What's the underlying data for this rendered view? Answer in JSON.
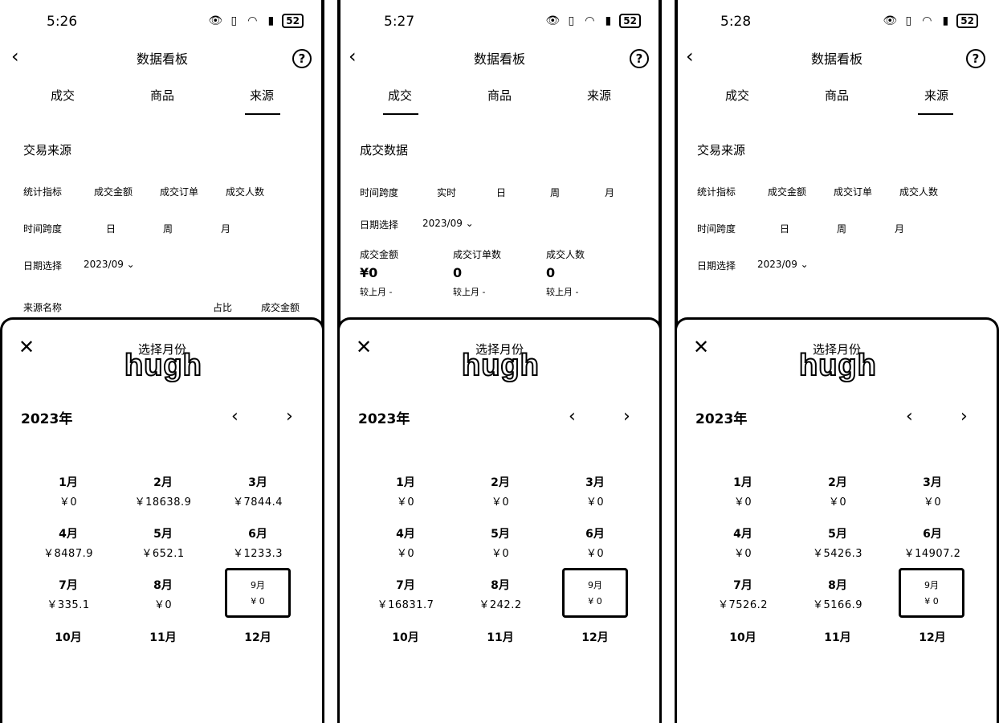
{
  "status": {
    "battery": "52"
  },
  "nav": {
    "title": "数据看板",
    "help": "?"
  },
  "tabs": [
    "成交",
    "商品",
    "来源"
  ],
  "labels": {
    "source_title": "交易来源",
    "deal_title": "成交数据",
    "metric_label": "统计指标",
    "metric_amount": "成交金额",
    "metric_orders": "成交订单",
    "metric_buyers": "成交人数",
    "time_span": "时间跨度",
    "realtime": "实时",
    "day": "日",
    "week": "周",
    "month": "月",
    "date_select": "日期选择",
    "date_value": "2023/09 ⌄",
    "source_name": "来源名称",
    "ratio": "占比",
    "amount": "成交金额",
    "deal_amount": "成交金额",
    "deal_orders": "成交订单数",
    "deal_buyers": "成交人数",
    "deal_amount_val": "¥0",
    "deal_orders_val": "0",
    "deal_buyers_val": "0",
    "compare": "较上月 -"
  },
  "sheet": {
    "title": "选择月份",
    "watermark": "hugh",
    "year": "2023年",
    "sel_top": "9月",
    "sel_bottom": "¥ 0"
  },
  "panels": [
    {
      "time": "5:26",
      "months": [
        {
          "label": "1月",
          "amount": "￥0"
        },
        {
          "label": "2月",
          "amount": "￥18638.9"
        },
        {
          "label": "3月",
          "amount": "￥7844.4"
        },
        {
          "label": "4月",
          "amount": "￥8487.9"
        },
        {
          "label": "5月",
          "amount": "￥652.1"
        },
        {
          "label": "6月",
          "amount": "￥1233.3"
        },
        {
          "label": "7月",
          "amount": "￥335.1"
        },
        {
          "label": "8月",
          "amount": "￥0"
        },
        {
          "label": "10月",
          "amount": ""
        },
        {
          "label": "11月",
          "amount": ""
        },
        {
          "label": "12月",
          "amount": ""
        }
      ]
    },
    {
      "time": "5:27",
      "months": [
        {
          "label": "1月",
          "amount": "￥0"
        },
        {
          "label": "2月",
          "amount": "￥0"
        },
        {
          "label": "3月",
          "amount": "￥0"
        },
        {
          "label": "4月",
          "amount": "￥0"
        },
        {
          "label": "5月",
          "amount": "￥0"
        },
        {
          "label": "6月",
          "amount": "￥0"
        },
        {
          "label": "7月",
          "amount": "￥16831.7"
        },
        {
          "label": "8月",
          "amount": "￥242.2"
        },
        {
          "label": "10月",
          "amount": ""
        },
        {
          "label": "11月",
          "amount": ""
        },
        {
          "label": "12月",
          "amount": ""
        }
      ]
    },
    {
      "time": "5:28",
      "months": [
        {
          "label": "1月",
          "amount": "￥0"
        },
        {
          "label": "2月",
          "amount": "￥0"
        },
        {
          "label": "3月",
          "amount": "￥0"
        },
        {
          "label": "4月",
          "amount": "￥0"
        },
        {
          "label": "5月",
          "amount": "￥5426.3"
        },
        {
          "label": "6月",
          "amount": "￥14907.2"
        },
        {
          "label": "7月",
          "amount": "￥7526.2"
        },
        {
          "label": "8月",
          "amount": "￥5166.9"
        },
        {
          "label": "10月",
          "amount": ""
        },
        {
          "label": "11月",
          "amount": ""
        },
        {
          "label": "12月",
          "amount": ""
        }
      ]
    }
  ]
}
